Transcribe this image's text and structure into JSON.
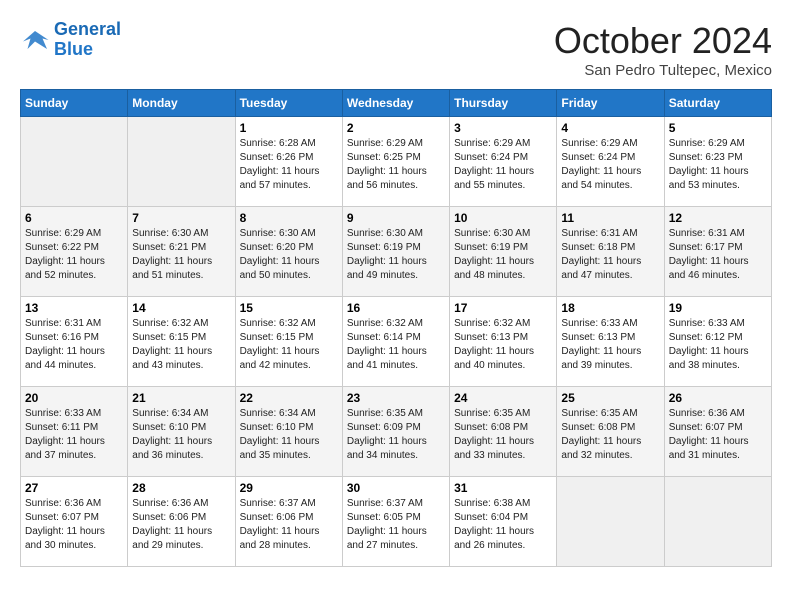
{
  "header": {
    "logo_line1": "General",
    "logo_line2": "Blue",
    "month": "October 2024",
    "location": "San Pedro Tultepec, Mexico"
  },
  "weekdays": [
    "Sunday",
    "Monday",
    "Tuesday",
    "Wednesday",
    "Thursday",
    "Friday",
    "Saturday"
  ],
  "weeks": [
    [
      {
        "day": "",
        "info": ""
      },
      {
        "day": "",
        "info": ""
      },
      {
        "day": "1",
        "info": "Sunrise: 6:28 AM\nSunset: 6:26 PM\nDaylight: 11 hours and 57 minutes."
      },
      {
        "day": "2",
        "info": "Sunrise: 6:29 AM\nSunset: 6:25 PM\nDaylight: 11 hours and 56 minutes."
      },
      {
        "day": "3",
        "info": "Sunrise: 6:29 AM\nSunset: 6:24 PM\nDaylight: 11 hours and 55 minutes."
      },
      {
        "day": "4",
        "info": "Sunrise: 6:29 AM\nSunset: 6:24 PM\nDaylight: 11 hours and 54 minutes."
      },
      {
        "day": "5",
        "info": "Sunrise: 6:29 AM\nSunset: 6:23 PM\nDaylight: 11 hours and 53 minutes."
      }
    ],
    [
      {
        "day": "6",
        "info": "Sunrise: 6:29 AM\nSunset: 6:22 PM\nDaylight: 11 hours and 52 minutes."
      },
      {
        "day": "7",
        "info": "Sunrise: 6:30 AM\nSunset: 6:21 PM\nDaylight: 11 hours and 51 minutes."
      },
      {
        "day": "8",
        "info": "Sunrise: 6:30 AM\nSunset: 6:20 PM\nDaylight: 11 hours and 50 minutes."
      },
      {
        "day": "9",
        "info": "Sunrise: 6:30 AM\nSunset: 6:19 PM\nDaylight: 11 hours and 49 minutes."
      },
      {
        "day": "10",
        "info": "Sunrise: 6:30 AM\nSunset: 6:19 PM\nDaylight: 11 hours and 48 minutes."
      },
      {
        "day": "11",
        "info": "Sunrise: 6:31 AM\nSunset: 6:18 PM\nDaylight: 11 hours and 47 minutes."
      },
      {
        "day": "12",
        "info": "Sunrise: 6:31 AM\nSunset: 6:17 PM\nDaylight: 11 hours and 46 minutes."
      }
    ],
    [
      {
        "day": "13",
        "info": "Sunrise: 6:31 AM\nSunset: 6:16 PM\nDaylight: 11 hours and 44 minutes."
      },
      {
        "day": "14",
        "info": "Sunrise: 6:32 AM\nSunset: 6:15 PM\nDaylight: 11 hours and 43 minutes."
      },
      {
        "day": "15",
        "info": "Sunrise: 6:32 AM\nSunset: 6:15 PM\nDaylight: 11 hours and 42 minutes."
      },
      {
        "day": "16",
        "info": "Sunrise: 6:32 AM\nSunset: 6:14 PM\nDaylight: 11 hours and 41 minutes."
      },
      {
        "day": "17",
        "info": "Sunrise: 6:32 AM\nSunset: 6:13 PM\nDaylight: 11 hours and 40 minutes."
      },
      {
        "day": "18",
        "info": "Sunrise: 6:33 AM\nSunset: 6:13 PM\nDaylight: 11 hours and 39 minutes."
      },
      {
        "day": "19",
        "info": "Sunrise: 6:33 AM\nSunset: 6:12 PM\nDaylight: 11 hours and 38 minutes."
      }
    ],
    [
      {
        "day": "20",
        "info": "Sunrise: 6:33 AM\nSunset: 6:11 PM\nDaylight: 11 hours and 37 minutes."
      },
      {
        "day": "21",
        "info": "Sunrise: 6:34 AM\nSunset: 6:10 PM\nDaylight: 11 hours and 36 minutes."
      },
      {
        "day": "22",
        "info": "Sunrise: 6:34 AM\nSunset: 6:10 PM\nDaylight: 11 hours and 35 minutes."
      },
      {
        "day": "23",
        "info": "Sunrise: 6:35 AM\nSunset: 6:09 PM\nDaylight: 11 hours and 34 minutes."
      },
      {
        "day": "24",
        "info": "Sunrise: 6:35 AM\nSunset: 6:08 PM\nDaylight: 11 hours and 33 minutes."
      },
      {
        "day": "25",
        "info": "Sunrise: 6:35 AM\nSunset: 6:08 PM\nDaylight: 11 hours and 32 minutes."
      },
      {
        "day": "26",
        "info": "Sunrise: 6:36 AM\nSunset: 6:07 PM\nDaylight: 11 hours and 31 minutes."
      }
    ],
    [
      {
        "day": "27",
        "info": "Sunrise: 6:36 AM\nSunset: 6:07 PM\nDaylight: 11 hours and 30 minutes."
      },
      {
        "day": "28",
        "info": "Sunrise: 6:36 AM\nSunset: 6:06 PM\nDaylight: 11 hours and 29 minutes."
      },
      {
        "day": "29",
        "info": "Sunrise: 6:37 AM\nSunset: 6:06 PM\nDaylight: 11 hours and 28 minutes."
      },
      {
        "day": "30",
        "info": "Sunrise: 6:37 AM\nSunset: 6:05 PM\nDaylight: 11 hours and 27 minutes."
      },
      {
        "day": "31",
        "info": "Sunrise: 6:38 AM\nSunset: 6:04 PM\nDaylight: 11 hours and 26 minutes."
      },
      {
        "day": "",
        "info": ""
      },
      {
        "day": "",
        "info": ""
      }
    ]
  ]
}
